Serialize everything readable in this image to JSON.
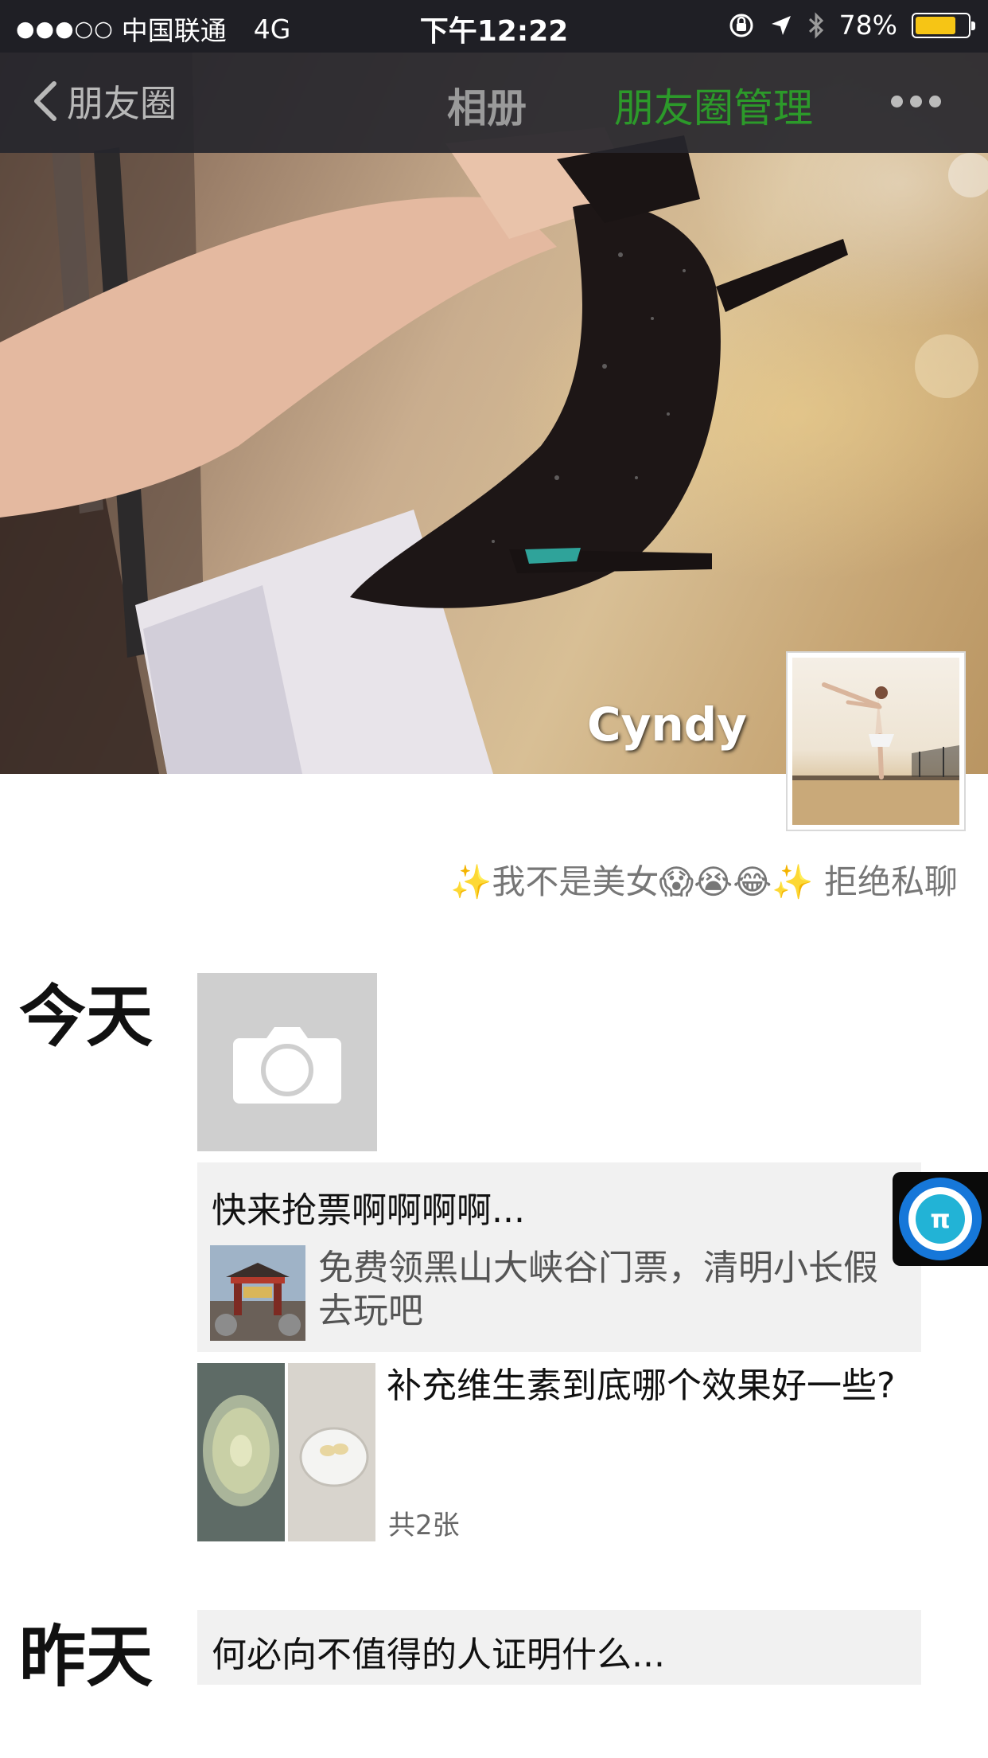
{
  "status_bar": {
    "signal": "●●●○○",
    "carrier": "中国联通",
    "network": "4G",
    "time": "下午12:22",
    "battery_percent": "78%",
    "battery_level": 0.78
  },
  "nav": {
    "back_label": "朋友圈",
    "title": "相册",
    "manage_label": "朋友圈管理"
  },
  "profile": {
    "name": "Cyndy",
    "signature_text_1": "我不是美女",
    "signature_text_2": "拒绝私聊",
    "signature_emojis": [
      "✨",
      "😱",
      "😭",
      "😂",
      "✨"
    ]
  },
  "timeline": {
    "today_label": "今天",
    "yesterday_label": "昨天",
    "share_post": {
      "text": "快来抢票啊啊啊啊...",
      "link_title": "免费领黑山大峡谷门票，清明小长假去玩吧"
    },
    "photo_post": {
      "text": "补充维生素到底哪个效果好一些?",
      "count": "共2张"
    },
    "yesterday_post": {
      "text": "何必向不值得的人证明什么..."
    }
  },
  "floating_button": {
    "symbol": "π"
  },
  "colors": {
    "accent_green": "#2c9a2a",
    "battery_yellow": "#f6c515",
    "card_gray": "#f1f1f1"
  }
}
